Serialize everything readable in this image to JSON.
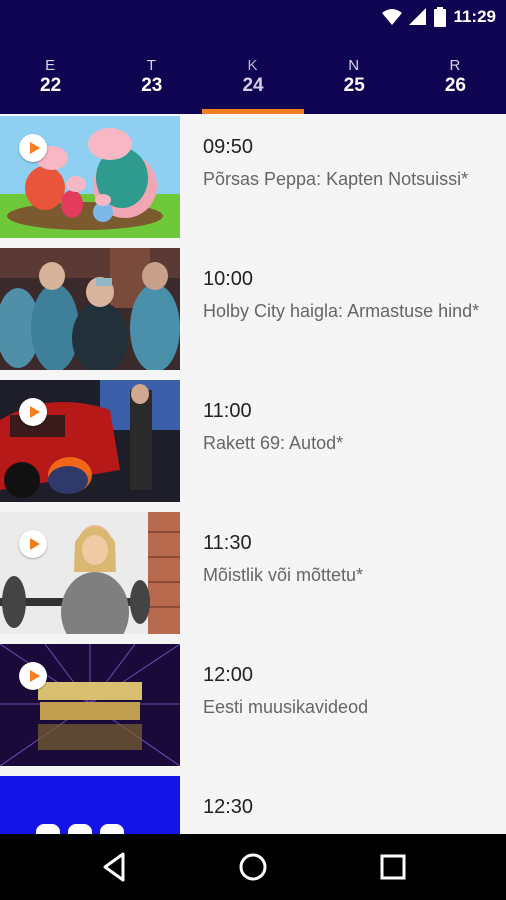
{
  "status_bar": {
    "time": "11:29",
    "icons": [
      "wifi-icon",
      "signal-icon",
      "battery-icon"
    ]
  },
  "days": [
    {
      "letter": "E",
      "number": "22",
      "active": false
    },
    {
      "letter": "T",
      "number": "23",
      "active": false
    },
    {
      "letter": "K",
      "number": "24",
      "active": true
    },
    {
      "letter": "N",
      "number": "25",
      "active": false
    },
    {
      "letter": "R",
      "number": "26",
      "active": false
    }
  ],
  "programs": [
    {
      "time": "09:50",
      "title": "Põrsas Peppa: Kapten Notsuissi*",
      "has_play": true
    },
    {
      "time": "10:00",
      "title": "Holby City haigla: Armastuse hind*",
      "has_play": false
    },
    {
      "time": "11:00",
      "title": "Rakett 69: Autod*",
      "has_play": true
    },
    {
      "time": "11:30",
      "title": "Mõistlik või mõttetu*",
      "has_play": true
    },
    {
      "time": "12:00",
      "title": "Eesti muusikavideod",
      "has_play": true
    },
    {
      "time": "12:30",
      "title": "",
      "has_play": false
    }
  ],
  "nav_bar": {
    "buttons": [
      "back-icon",
      "home-icon",
      "recents-icon"
    ]
  },
  "colors": {
    "header": "#0e0452",
    "accent": "#f47d20",
    "background": "#f5f5f5"
  }
}
